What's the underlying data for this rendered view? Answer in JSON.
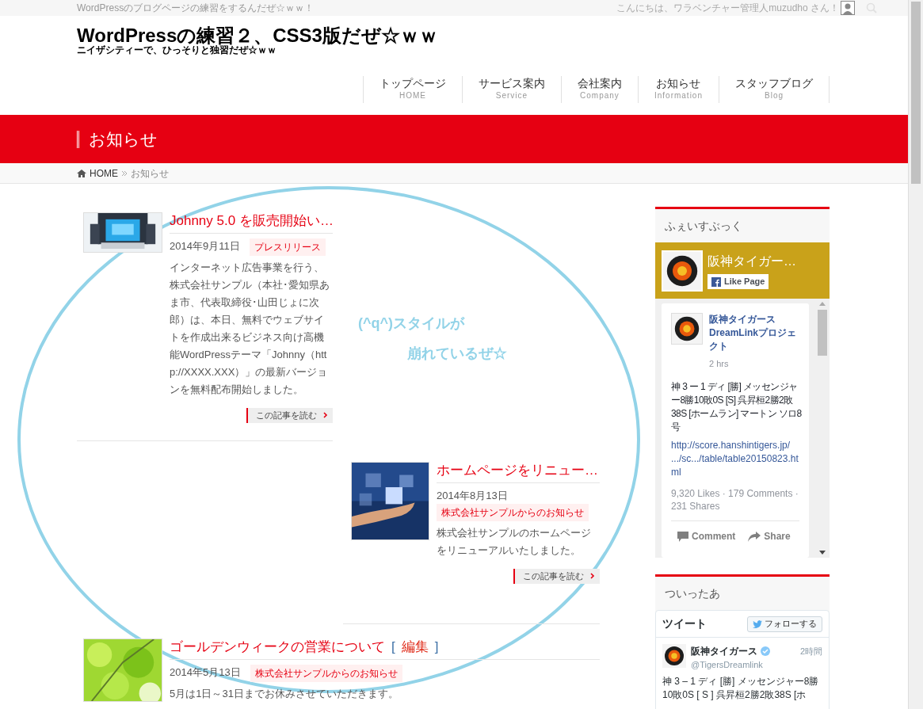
{
  "top_bar": {
    "tagline": "WordPressのブログページの練習をするんだぜ☆ｗｗ！",
    "greeting": "こんにちは、ワラベンチャー管理人muzudho さん！"
  },
  "header": {
    "title": "WordPressの練習２、CSS3版だぜ☆ｗｗ",
    "subtitle": "ニイザシティーで、ひっそりと独習だぜ☆ｗｗ"
  },
  "nav": [
    {
      "label": "トップページ",
      "sublabel": "HOME"
    },
    {
      "label": "サービス案内",
      "sublabel": "Service"
    },
    {
      "label": "会社案内",
      "sublabel": "Company"
    },
    {
      "label": "お知らせ",
      "sublabel": "Information"
    },
    {
      "label": "スタッフブログ",
      "sublabel": "Blog"
    }
  ],
  "page_banner": {
    "title": "お知らせ"
  },
  "breadcrumb": [
    {
      "label": "HOME"
    },
    {
      "label": "お知らせ"
    }
  ],
  "articles": [
    {
      "title": "Johnny 5.0 を販売開始い…",
      "date": "2014年9月11日",
      "category": "プレスリリース",
      "excerpt": "インターネット広告事業を行う、株式会社サンプル（本社･愛知県あま市、代表取締役･山田じょに次郎）は、本日、無料でウェブサイトを作成出来るビジネス向け高機能WordPressテーマ「Johnny（http://XXXX.XXX）」の最新バージョンを無料配布開始しました。",
      "read_more": "この記事を読む"
    },
    {
      "title": "ホームページをリニュー…",
      "date": "2014年8月13日",
      "category": "株式会社サンプルからのお知らせ",
      "excerpt": "株式会社サンプルのホームページをリニューアルいたしました。",
      "read_more": "この記事を読む"
    },
    {
      "title": "ゴールデンウィークの営業について",
      "edit": {
        "before": "[",
        "label": "編集",
        "after": "]"
      },
      "date": "2014年5月13日",
      "category": "株式会社サンプルからのお知らせ",
      "excerpt": "5月は1日～31日までお休みさせていただきます。"
    }
  ],
  "annotation": {
    "lines": [
      "(^q^)スタイルが",
      "崩れているぜ☆"
    ]
  },
  "facebook_widget": {
    "heading": "ふぇいすぶっく",
    "page_name": "阪神タイガー…",
    "like_button": "Like Page",
    "post": {
      "author": "阪神タイガース DreamLinkプロジェクト",
      "time": "2 hrs",
      "text": "神 3 ー 1 ディ [勝] メッセンジャー8勝10敗0S [S] 呉昇桓2勝2敗38S [ホームラン] マートン ソロ8号",
      "link": "http://score.hanshintigers.jp/ .../sc.../table/table20150823.html",
      "stats": "9,320 Likes · 179 Comments · 231 Shares",
      "actions": [
        {
          "kind": "comment",
          "label": "Comment"
        },
        {
          "kind": "share",
          "label": "Share"
        }
      ]
    }
  },
  "twitter_widget": {
    "heading": "ついったあ",
    "title": "ツイート",
    "follow_button": "フォローする",
    "tweet": {
      "name": "阪神タイガース",
      "handle": "@TigersDreamlink",
      "time": "2時間",
      "text": "神 3 – 1 ディ [勝] メッセンジャー8勝10敗0S [ S ] 呉昇桓2勝2敗38S [ホ"
    }
  }
}
